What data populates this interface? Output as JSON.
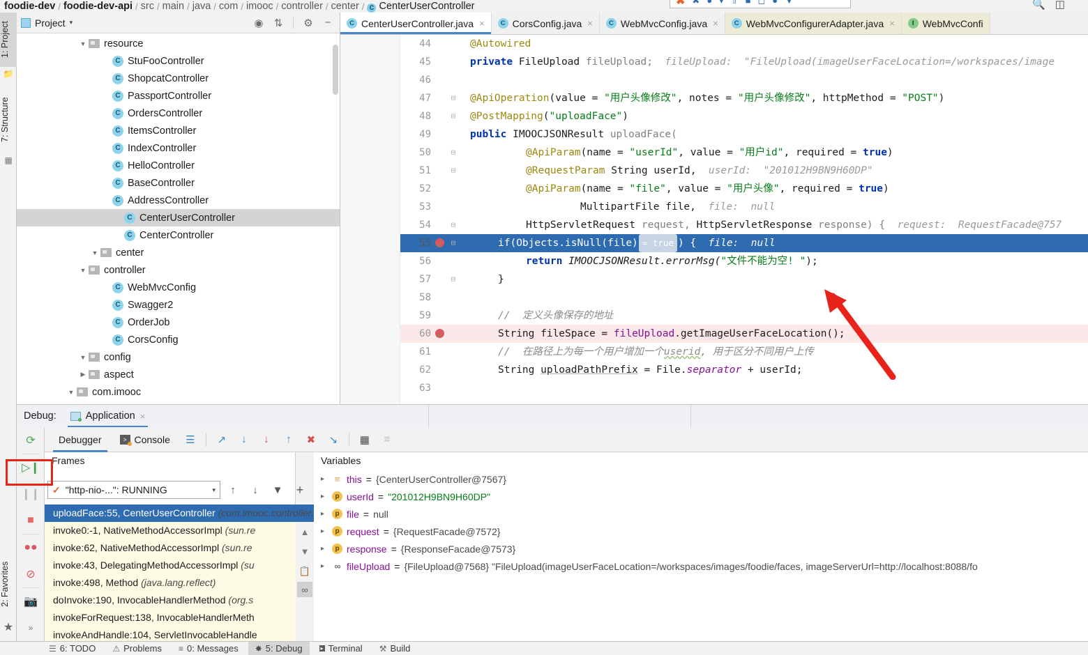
{
  "breadcrumb": {
    "items": [
      {
        "label": "foodie-dev",
        "bold": true
      },
      {
        "label": "foodie-dev-api",
        "bold": true
      },
      {
        "label": "src",
        "bold": false
      },
      {
        "label": "main",
        "bold": false
      },
      {
        "label": "java",
        "bold": false
      },
      {
        "label": "com",
        "bold": false
      },
      {
        "label": "imooc",
        "bold": false
      },
      {
        "label": "controller",
        "bold": false
      },
      {
        "label": "center",
        "bold": false
      },
      {
        "label": "CenterUserController",
        "bold": false,
        "icon": "class-icon"
      }
    ],
    "separator": "/"
  },
  "top_toolbar": {
    "icons": [
      "hammer-icon",
      "close-icon",
      "run-icon",
      "debug-icon",
      "coverage-icon",
      "profile-icon",
      "stop-icon",
      "layout-icon",
      "sync-icon"
    ],
    "search_icon": "search-icon",
    "window_icon": "window-icon"
  },
  "left_tool_strip": {
    "tabs": [
      {
        "label": "1: Project",
        "icon": "project-folder-icon",
        "selected": true
      },
      {
        "label": "7: Structure",
        "icon": "structure-icon",
        "selected": false
      }
    ],
    "bottom_tabs": [
      {
        "label": "2: Favorites",
        "icon": "star-icon"
      }
    ]
  },
  "project_panel": {
    "title": "Project",
    "caret": "▾",
    "toolbar_icons": [
      "locate-icon",
      "collapse-all-icon",
      "gear-icon",
      "hide-icon"
    ],
    "tree": [
      {
        "label": "com.imooc",
        "type": "package",
        "indent": 4,
        "twisty": "▼",
        "selected": false
      },
      {
        "label": "aspect",
        "type": "folder",
        "indent": 5,
        "twisty": "▶",
        "selected": false
      },
      {
        "label": "config",
        "type": "folder",
        "indent": 5,
        "twisty": "▼",
        "selected": false
      },
      {
        "label": "CorsConfig",
        "type": "class",
        "indent": 7,
        "twisty": "",
        "selected": false
      },
      {
        "label": "OrderJob",
        "type": "class",
        "indent": 7,
        "twisty": "",
        "selected": false
      },
      {
        "label": "Swagger2",
        "type": "class",
        "indent": 7,
        "twisty": "",
        "selected": false
      },
      {
        "label": "WebMvcConfig",
        "type": "class",
        "indent": 7,
        "twisty": "",
        "selected": false
      },
      {
        "label": "controller",
        "type": "folder",
        "indent": 5,
        "twisty": "▼",
        "selected": false
      },
      {
        "label": "center",
        "type": "folder",
        "indent": 6,
        "twisty": "▼",
        "selected": false
      },
      {
        "label": "CenterController",
        "type": "class",
        "indent": 8,
        "twisty": "",
        "selected": false
      },
      {
        "label": "CenterUserController",
        "type": "class",
        "indent": 8,
        "twisty": "",
        "selected": true
      },
      {
        "label": "AddressController",
        "type": "class",
        "indent": 7,
        "twisty": "",
        "selected": false
      },
      {
        "label": "BaseController",
        "type": "class",
        "indent": 7,
        "twisty": "",
        "selected": false
      },
      {
        "label": "HelloController",
        "type": "class",
        "indent": 7,
        "twisty": "",
        "selected": false
      },
      {
        "label": "IndexController",
        "type": "class",
        "indent": 7,
        "twisty": "",
        "selected": false
      },
      {
        "label": "ItemsController",
        "type": "class",
        "indent": 7,
        "twisty": "",
        "selected": false
      },
      {
        "label": "OrdersController",
        "type": "class",
        "indent": 7,
        "twisty": "",
        "selected": false
      },
      {
        "label": "PassportController",
        "type": "class",
        "indent": 7,
        "twisty": "",
        "selected": false
      },
      {
        "label": "ShopcatController",
        "type": "class",
        "indent": 7,
        "twisty": "",
        "selected": false
      },
      {
        "label": "StuFooController",
        "type": "class",
        "indent": 7,
        "twisty": "",
        "selected": false
      },
      {
        "label": "resource",
        "type": "folder",
        "indent": 5,
        "twisty": "▼",
        "selected": false
      }
    ]
  },
  "editor_tabs": [
    {
      "label": "CenterUserController.java",
      "icon": "class-icon",
      "active": true,
      "modified_bg": false
    },
    {
      "label": "CorsConfig.java",
      "icon": "class-icon",
      "active": false,
      "modified_bg": false
    },
    {
      "label": "WebMvcConfig.java",
      "icon": "class-icon",
      "active": false,
      "modified_bg": false
    },
    {
      "label": "WebMvcConfigurerAdapter.java",
      "icon": "class-readonly-icon",
      "active": false,
      "modified_bg": true
    },
    {
      "label": "WebMvcConfi",
      "icon": "interface-readonly-icon",
      "active": false,
      "modified_bg": true
    }
  ],
  "editor": {
    "lines": [
      {
        "n": 44,
        "fold": "",
        "mark": "",
        "hl": false,
        "bp": false
      },
      {
        "n": 45,
        "fold": "",
        "mark": "",
        "hl": false,
        "bp": false
      },
      {
        "n": 46,
        "fold": "",
        "mark": "",
        "hl": false,
        "bp": false
      },
      {
        "n": 47,
        "fold": "⊟",
        "mark": "",
        "hl": false,
        "bp": false
      },
      {
        "n": 48,
        "fold": "⊟",
        "mark": "",
        "hl": false,
        "bp": false
      },
      {
        "n": 49,
        "fold": "",
        "mark": "",
        "hl": false,
        "bp": false
      },
      {
        "n": 50,
        "fold": "⊟",
        "mark": "",
        "hl": false,
        "bp": false
      },
      {
        "n": 51,
        "fold": "⊟",
        "mark": "",
        "hl": false,
        "bp": false
      },
      {
        "n": 52,
        "fold": "",
        "mark": "",
        "hl": false,
        "bp": false
      },
      {
        "n": 53,
        "fold": "",
        "mark": "",
        "hl": false,
        "bp": false
      },
      {
        "n": 54,
        "fold": "⊟",
        "mark": "",
        "hl": false,
        "bp": false
      },
      {
        "n": 55,
        "fold": "⊟",
        "mark": "breakpoint",
        "hl": true,
        "bp": false
      },
      {
        "n": 56,
        "fold": "",
        "mark": "",
        "hl": false,
        "bp": false
      },
      {
        "n": 57,
        "fold": "⊟",
        "mark": "",
        "hl": false,
        "bp": false
      },
      {
        "n": 58,
        "fold": "",
        "mark": "",
        "hl": false,
        "bp": false
      },
      {
        "n": 59,
        "fold": "",
        "mark": "",
        "hl": false,
        "bp": false
      },
      {
        "n": 60,
        "fold": "",
        "mark": "breakpoint",
        "hl": false,
        "bp": true
      },
      {
        "n": 61,
        "fold": "",
        "mark": "",
        "hl": false,
        "bp": false
      },
      {
        "n": 62,
        "fold": "",
        "mark": "",
        "hl": false,
        "bp": false
      },
      {
        "n": 63,
        "fold": "",
        "mark": "",
        "hl": false,
        "bp": false
      }
    ],
    "code_text": {
      "l44": "@Autowired",
      "l45_kw": "private",
      "l45_type": "FileUpload",
      "l45_var": "fileUpload;",
      "l45_hint": "fileUpload:  \"FileUpload(imageUserFaceLocation=/workspaces/image",
      "l47_anno": "@ApiOperation",
      "l47_rest": "(value = ",
      "l47_s1": "\"用户头像修改\"",
      "l47_mid": ", notes = ",
      "l47_s2": "\"用户头像修改\"",
      "l47_mid2": ", httpMethod = ",
      "l47_s3": "\"POST\"",
      "l47_end": ")",
      "l48_anno": "@PostMapping",
      "l48_s": "\"uploadFace\"",
      "l49_kw": "public",
      "l49_type": "IMOOCJSONResult",
      "l49_m": "uploadFace(",
      "l50_anno": "@ApiParam",
      "l50_p1": "(name = ",
      "l50_s1": "\"userId\"",
      "l50_p2": ", value = ",
      "l50_s2": "\"用户id\"",
      "l50_p3": ", required = ",
      "l50_kw": "true",
      "l50_end": ")",
      "l51_anno": "@RequestParam",
      "l51_rest": " String userId,",
      "l51_hint": "userId:  \"201012H9BN9H60DP\"",
      "l52_anno": "@ApiParam",
      "l52_p1": "(name = ",
      "l52_s1": "\"file\"",
      "l52_p2": ", value = ",
      "l52_s2": "\"用户头像\"",
      "l52_p3": ", required = ",
      "l52_kw": "true",
      "l52_end": ")",
      "l53_type": "MultipartFile file,",
      "l53_hint": "file:  null",
      "l54_t1": "HttpServletRequest",
      "l54_v1": " request, ",
      "l54_t2": "HttpServletResponse",
      "l54_v2": " response) {",
      "l54_hint": "request:  RequestFacade@757",
      "l55_code": "if(Objects.isNull(file)",
      "l55_badge": "= true",
      "l55_rest": ") {",
      "l55_hint": "file:  null",
      "l56_kw": "return",
      "l56_expr": " IMOOCJSONResult.errorMsg(",
      "l56_s": "\"文件不能为空! \"",
      "l56_end": ");",
      "l57_code": "}",
      "l59_cmt": "//  定义头像保存的地址",
      "l60_t": "String fileSpace = ",
      "l60_fld": "fileUpload",
      "l60_rest": ".getImageUserFaceLocation();",
      "l61_cmt_a": "//  在路径上为每一个用户增加一个",
      "l61_cmt_b": "userid",
      "l61_cmt_c": ", 用于区分不同用户上传",
      "l62_a": "String ",
      "l62_var": "uploadPathPrefix",
      "l62_b": " = File.",
      "l62_fld": "separator",
      "l62_c": " + userId;"
    }
  },
  "debug": {
    "title_label": "Debug:",
    "app_tab": "Application",
    "close_glyph": "×",
    "tabs": [
      {
        "label": "Debugger",
        "icon": "",
        "active": true
      },
      {
        "label": "Console",
        "icon": "console-icon",
        "active": false
      }
    ],
    "toolbar_icons": [
      "mute-breakpoints-icon",
      "step-over-icon",
      "step-into-icon",
      "force-step-into-icon",
      "step-out-icon",
      "drop-frame-icon",
      "run-to-cursor-icon",
      "evaluate-expression-icon",
      "settings-icon"
    ],
    "side_buttons": [
      "rerun-icon",
      "resume-program-icon",
      "pause-program-icon",
      "stop-icon",
      "view-breakpoints-icon",
      "mute-breakpoints-icon",
      "screenshot-icon",
      "more-icon"
    ],
    "frames": {
      "header": "Frames",
      "thread_value": "\"http-nio-...\": RUNNING",
      "thread_caret": "▾",
      "thread_icons": [
        "up-arrow-icon",
        "down-arrow-icon",
        "filter-icon",
        "plus-icon"
      ],
      "rows": [
        {
          "text": "uploadFace:55, CenterUserController ",
          "pkg": "(com.imooc.controller.center)",
          "selected": true
        },
        {
          "text": "invoke0:-1, NativeMethodAccessorImpl ",
          "pkg": "(sun.re",
          "selected": false
        },
        {
          "text": "invoke:62, NativeMethodAccessorImpl ",
          "pkg": "(sun.re",
          "selected": false
        },
        {
          "text": "invoke:43, DelegatingMethodAccessorImpl ",
          "pkg": "(su",
          "selected": false
        },
        {
          "text": "invoke:498, Method ",
          "pkg": "(java.lang.reflect)",
          "selected": false
        },
        {
          "text": "doInvoke:190, InvocableHandlerMethod ",
          "pkg": "(org.s",
          "selected": false
        },
        {
          "text": "invokeForRequest:138, InvocableHandlerMeth",
          "pkg": "",
          "selected": false
        },
        {
          "text": "invokeAndHandle:104, ServletInvocableHandle",
          "pkg": "",
          "selected": false
        }
      ],
      "scroll_icons": [
        "scroll-up-icon",
        "scroll-down-icon",
        "copy-stack-icon",
        "glasses-icon"
      ]
    },
    "variables": {
      "header": "Variables",
      "rows": [
        {
          "arrow": "▸",
          "badge": "≡",
          "badge_type": "lines",
          "name": "this",
          "eq": " = ",
          "value": "{CenterUserController@7567}",
          "value_type": "obj"
        },
        {
          "arrow": "▸",
          "badge": "p",
          "badge_type": "param",
          "name": "userId",
          "eq": " = ",
          "value": "\"201012H9BN9H60DP\"",
          "value_type": "str"
        },
        {
          "arrow": "▸",
          "badge": "p",
          "badge_type": "param",
          "name": "file",
          "eq": " = ",
          "value": "null",
          "value_type": "obj"
        },
        {
          "arrow": "▸",
          "badge": "p",
          "badge_type": "param",
          "name": "request",
          "eq": " = ",
          "value": "{RequestFacade@7572}",
          "value_type": "obj"
        },
        {
          "arrow": "▸",
          "badge": "p",
          "badge_type": "param",
          "name": "response",
          "eq": " = ",
          "value": "{ResponseFacade@7573}",
          "value_type": "obj"
        },
        {
          "arrow": "▸",
          "badge": "∞",
          "badge_type": "glasses",
          "name": "fileUpload",
          "eq": " = ",
          "value": "{FileUpload@7568} \"FileUpload(imageUserFaceLocation=/workspaces/images/foodie/faces, imageServerUrl=http://localhost:8088/fo",
          "value_type": "obj"
        }
      ]
    }
  },
  "bottom_bar": {
    "items": [
      {
        "label": "6: TODO",
        "icon": "todo-icon",
        "active": false
      },
      {
        "label": "Problems",
        "icon": "problems-icon",
        "active": false
      },
      {
        "label": "0: Messages",
        "icon": "messages-icon",
        "active": false
      },
      {
        "label": "5: Debug",
        "icon": "debug-icon",
        "active": true
      },
      {
        "label": "Terminal",
        "icon": "terminal-icon",
        "active": false
      },
      {
        "label": "Build",
        "icon": "build-icon",
        "active": false
      }
    ]
  },
  "annotations": {
    "arrow_color": "#e8231a",
    "rect_color": "#e8231a"
  }
}
